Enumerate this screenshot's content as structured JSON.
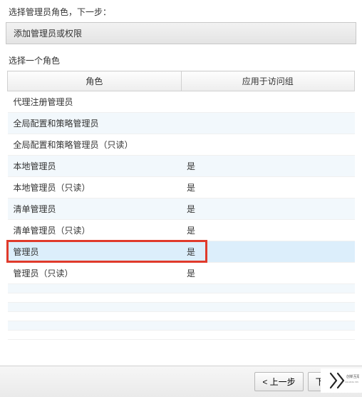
{
  "page": {
    "title": "选择管理员角色，下一步：",
    "sectionHeader": "添加管理员或权限",
    "subtitle": "选择一个角色"
  },
  "table": {
    "columns": {
      "role": "角色",
      "apply": "应用于访问组"
    },
    "rows": [
      {
        "role": "代理注册管理员",
        "apply": ""
      },
      {
        "role": "全局配置和策略管理员",
        "apply": ""
      },
      {
        "role": "全局配置和策略管理员（只读）",
        "apply": ""
      },
      {
        "role": "本地管理员",
        "apply": "是"
      },
      {
        "role": "本地管理员（只读）",
        "apply": "是"
      },
      {
        "role": "清单管理员",
        "apply": "是"
      },
      {
        "role": "清单管理员（只读）",
        "apply": "是"
      },
      {
        "role": "管理员",
        "apply": "是",
        "selected": true,
        "highlighted": true
      },
      {
        "role": "管理员（只读）",
        "apply": "是"
      },
      {
        "role": "",
        "apply": ""
      },
      {
        "role": "",
        "apply": ""
      },
      {
        "role": "",
        "apply": ""
      },
      {
        "role": "",
        "apply": ""
      },
      {
        "role": "",
        "apply": ""
      },
      {
        "role": "",
        "apply": ""
      }
    ]
  },
  "footer": {
    "prev": "< 上一步",
    "next": "下一步 >"
  },
  "watermark": "创新互联"
}
